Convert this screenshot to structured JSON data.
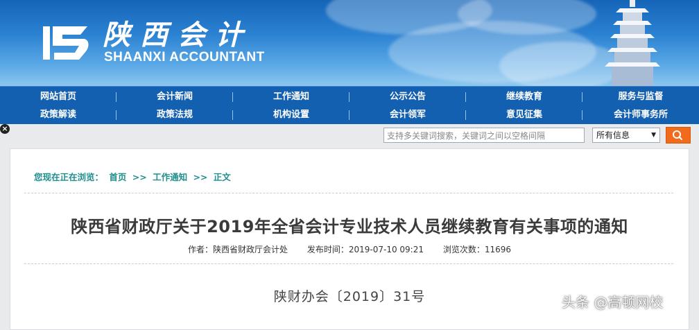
{
  "header": {
    "logo_cn": "陕西会计",
    "logo_en": "SHAANXI ACCOUNTANT"
  },
  "nav": {
    "row1": [
      "网站首页",
      "会计新闻",
      "工作通知",
      "公示公告",
      "继续教育",
      "服务与监督"
    ],
    "row2": [
      "政策解读",
      "政策法规",
      "机构设置",
      "会计领军",
      "意见征集",
      "会计师事务所"
    ]
  },
  "search": {
    "placeholder": "支持多关键词搜索，关键词之间以空格间隔",
    "scope": "所有信息",
    "button_icon": "search-icon"
  },
  "breadcrumb": [
    "您现在正在浏览：",
    "首页",
    ">>",
    "工作通知",
    ">>",
    "正文"
  ],
  "article": {
    "title": "陕西省财政厅关于2019年全省会计专业技术人员继续教育有关事项的通知",
    "author": "作者：陕西省财政厅会计处",
    "published": "发布时间：2019-07-10 09:21",
    "views": "浏览次数：11696",
    "doc_number": "陕财办会〔2019〕31号"
  },
  "watermark": "头条 @高顿网校",
  "colors": {
    "nav_bg": "#135fb0",
    "breadcrumb": "#1f8f8c",
    "search_button": "#f26a1b"
  }
}
